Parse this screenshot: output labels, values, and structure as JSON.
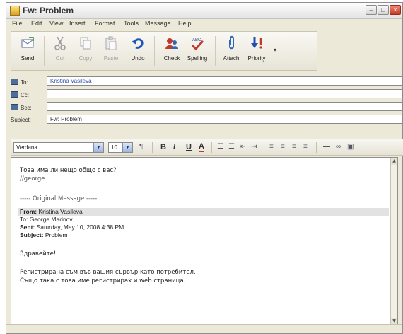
{
  "window": {
    "title": "Fw: Problem"
  },
  "menu": [
    "File",
    "Edit",
    "View",
    "Insert",
    "Format",
    "Tools",
    "Message",
    "Help"
  ],
  "toolbar": {
    "send": "Send",
    "cut": "Cut",
    "copy": "Copy",
    "paste": "Paste",
    "undo": "Undo",
    "check": "Check",
    "spelling": "Spelling",
    "attach": "Attach",
    "priority": "Priority"
  },
  "fields": {
    "to_label": "To:",
    "to_value": "Kristina Vasileva",
    "cc_label": "Cc:",
    "cc_value": "",
    "bcc_label": "Bcc:",
    "bcc_value": "",
    "subject_label": "Subject:",
    "subject_value": "Fw: Problem"
  },
  "format": {
    "font": "Verdana",
    "size": "10",
    "bold": "B",
    "italic": "I",
    "underline": "U",
    "color": "A"
  },
  "body": {
    "line1": "Това има ли нещо общо с вас?",
    "line2": "//george",
    "original": "----- Original Message -----",
    "from_label": "From:",
    "from_value": "Kristina Vasileva",
    "to_label": "To:",
    "to_value": "George Marinov",
    "sent_label": "Sent:",
    "sent_value": "Saturday, May 10, 2008 4:38 PM",
    "subject_label": "Subject:",
    "subject_value": "Problem",
    "greeting": "Здравейте!",
    "p1": "Регистрирана съм във вашия сървър като потребител.",
    "p2": "Също така с това име регистрирах и web страница."
  }
}
